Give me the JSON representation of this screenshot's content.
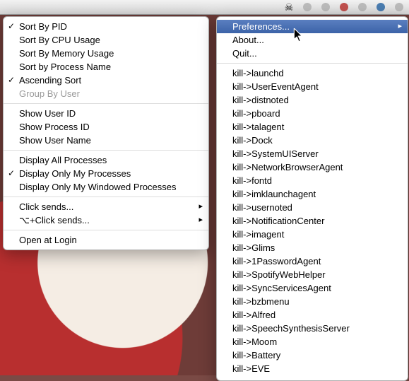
{
  "menubar": {
    "status_icon": "skull-icon",
    "extras": [
      "status-dot",
      "status-dot",
      "status-dot",
      "status-dot",
      "status-dot",
      "status-dot"
    ]
  },
  "left_menu": {
    "items": [
      {
        "label": "Sort By PID",
        "checked": true
      },
      {
        "label": "Sort By CPU Usage"
      },
      {
        "label": "Sort By Memory Usage"
      },
      {
        "label": "Sort by Process Name"
      },
      {
        "label": "Ascending Sort",
        "checked": true
      },
      {
        "label": "Group By User",
        "disabled": true
      },
      {
        "sep": true
      },
      {
        "label": "Show User ID"
      },
      {
        "label": "Show Process ID"
      },
      {
        "label": "Show User Name"
      },
      {
        "sep": true
      },
      {
        "label": "Display All Processes"
      },
      {
        "label": "Display Only My Processes",
        "checked": true
      },
      {
        "label": "Display Only My Windowed Processes"
      },
      {
        "sep": true
      },
      {
        "label": "Click sends...",
        "submenu": true
      },
      {
        "label": "⌥+Click sends...",
        "submenu": true
      },
      {
        "sep": true
      },
      {
        "label": "Open at Login"
      }
    ]
  },
  "right_menu": {
    "items": [
      {
        "label": "Preferences...",
        "submenu": true,
        "highlight": true
      },
      {
        "label": "About..."
      },
      {
        "label": "Quit..."
      },
      {
        "sep": true
      },
      {
        "label": "kill->launchd"
      },
      {
        "label": "kill->UserEventAgent"
      },
      {
        "label": "kill->distnoted"
      },
      {
        "label": "kill->pboard"
      },
      {
        "label": "kill->talagent"
      },
      {
        "label": "kill->Dock"
      },
      {
        "label": "kill->SystemUIServer"
      },
      {
        "label": "kill->NetworkBrowserAgent"
      },
      {
        "label": "kill->fontd"
      },
      {
        "label": "kill->imklaunchagent"
      },
      {
        "label": "kill->usernoted"
      },
      {
        "label": "kill->NotificationCenter"
      },
      {
        "label": "kill->imagent"
      },
      {
        "label": "kill->Glims"
      },
      {
        "label": "kill->1PasswordAgent"
      },
      {
        "label": "kill->SpotifyWebHelper"
      },
      {
        "label": "kill->SyncServicesAgent"
      },
      {
        "label": "kill->bzbmenu"
      },
      {
        "label": "kill->Alfred"
      },
      {
        "label": "kill->SpeechSynthesisServer"
      },
      {
        "label": "kill->Moom"
      },
      {
        "label": "kill->Battery"
      },
      {
        "label": "kill->EVE"
      }
    ]
  }
}
